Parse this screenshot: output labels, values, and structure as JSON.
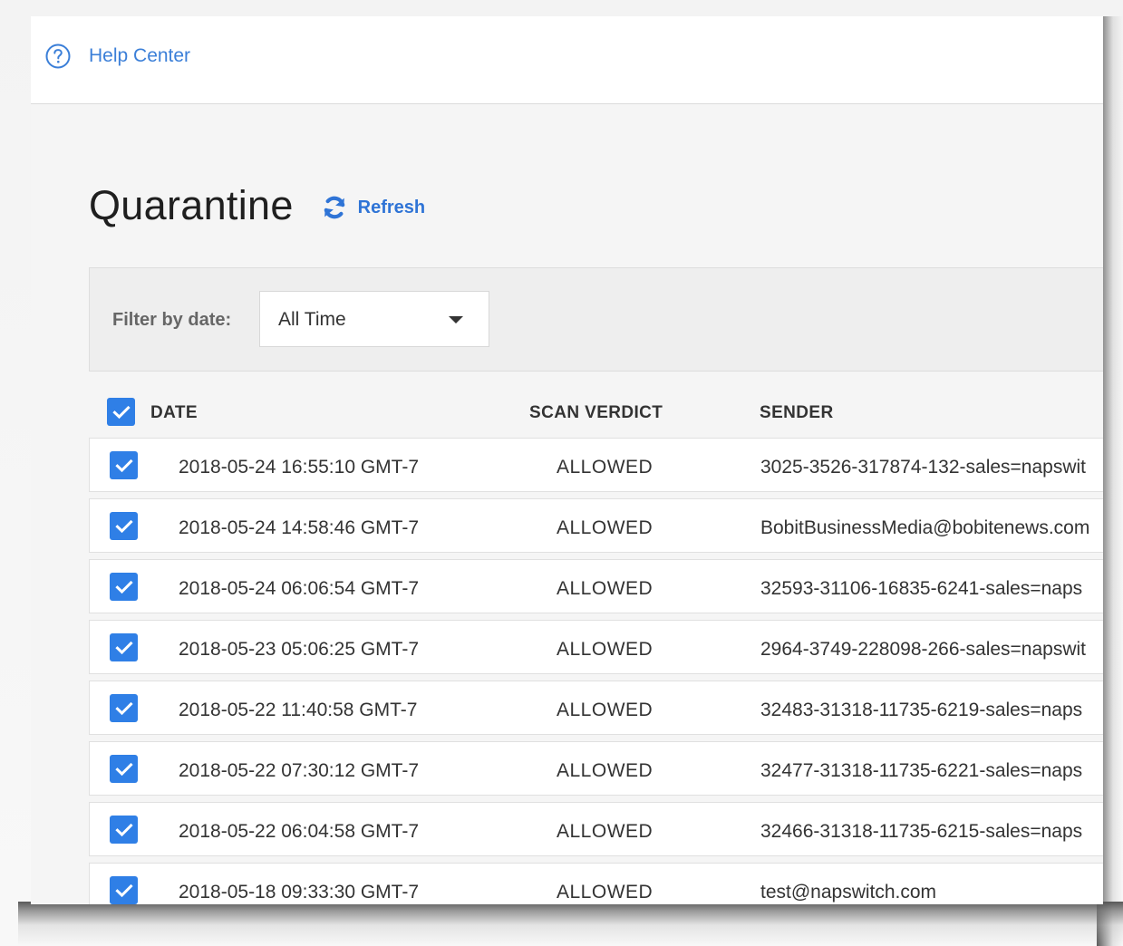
{
  "header": {
    "help_label": "Help Center"
  },
  "page": {
    "title": "Quarantine",
    "refresh_label": "Refresh"
  },
  "filter": {
    "label": "Filter by date:",
    "selected": "All Time"
  },
  "table": {
    "columns": {
      "date": "DATE",
      "verdict": "SCAN VERDICT",
      "sender": "SENDER"
    },
    "select_all_checked": true,
    "rows": [
      {
        "date": "2018-05-24 16:55:10 GMT-7",
        "verdict": "ALLOWED",
        "sender": "3025-3526-317874-132-sales=napswit",
        "checked": true
      },
      {
        "date": "2018-05-24 14:58:46 GMT-7",
        "verdict": "ALLOWED",
        "sender": "BobitBusinessMedia@bobitenews.com",
        "checked": true
      },
      {
        "date": "2018-05-24 06:06:54 GMT-7",
        "verdict": "ALLOWED",
        "sender": "32593-31106-16835-6241-sales=naps",
        "checked": true
      },
      {
        "date": "2018-05-23 05:06:25 GMT-7",
        "verdict": "ALLOWED",
        "sender": "2964-3749-228098-266-sales=napswit",
        "checked": true
      },
      {
        "date": "2018-05-22 11:40:58 GMT-7",
        "verdict": "ALLOWED",
        "sender": "32483-31318-11735-6219-sales=naps",
        "checked": true
      },
      {
        "date": "2018-05-22 07:30:12 GMT-7",
        "verdict": "ALLOWED",
        "sender": "32477-31318-11735-6221-sales=naps",
        "checked": true
      },
      {
        "date": "2018-05-22 06:04:58 GMT-7",
        "verdict": "ALLOWED",
        "sender": "32466-31318-11735-6215-sales=naps",
        "checked": true
      },
      {
        "date": "2018-05-18 09:33:30 GMT-7",
        "verdict": "ALLOWED",
        "sender": "test@napswitch.com",
        "checked": true
      }
    ]
  },
  "colors": {
    "accent": "#2f7fe6",
    "link": "#3b7fd8",
    "filter_bar": "#eeeeee"
  },
  "icons": {
    "help": "question-circle-icon",
    "refresh": "refresh-icon",
    "checkbox": "checkmark-icon",
    "dropdown": "caret-down-icon"
  }
}
